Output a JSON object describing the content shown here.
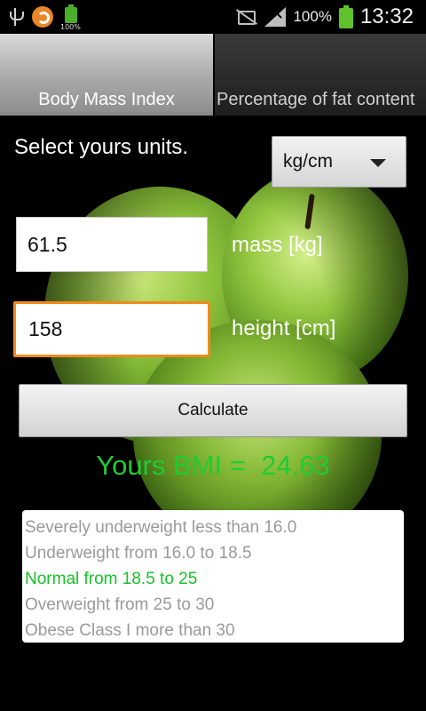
{
  "status_bar": {
    "battery_small_label": "100%",
    "battery_percent": "100%",
    "time": "13:32",
    "icons": [
      "usb-icon",
      "avast-icon",
      "battery-small-icon",
      "mute-icon",
      "signal-icon",
      "battery-icon"
    ]
  },
  "tabs": [
    {
      "label": "Body Mass Index",
      "selected": true
    },
    {
      "label": "Percentage of fat content",
      "selected": false
    }
  ],
  "units": {
    "label": "Select yours units.",
    "selected": "kg/cm"
  },
  "mass": {
    "value": "61.5",
    "label": "mass [kg]"
  },
  "height": {
    "value": "158",
    "label": "height [cm]"
  },
  "calculate_label": "Calculate",
  "result": {
    "text": "Yours BMI =  24.63"
  },
  "categories": [
    {
      "label": "Severely underweight less than 16.0",
      "active": false
    },
    {
      "label": "Underweight from 16.0 to 18.5",
      "active": false
    },
    {
      "label": "Normal from 18.5 to 25",
      "active": true
    },
    {
      "label": "Overweight from 25 to 30",
      "active": false
    },
    {
      "label": "Obese Class I more than 30",
      "active": false
    }
  ],
  "colors": {
    "accent_green": "#1fcc33",
    "focus_orange": "#f08a1c"
  }
}
